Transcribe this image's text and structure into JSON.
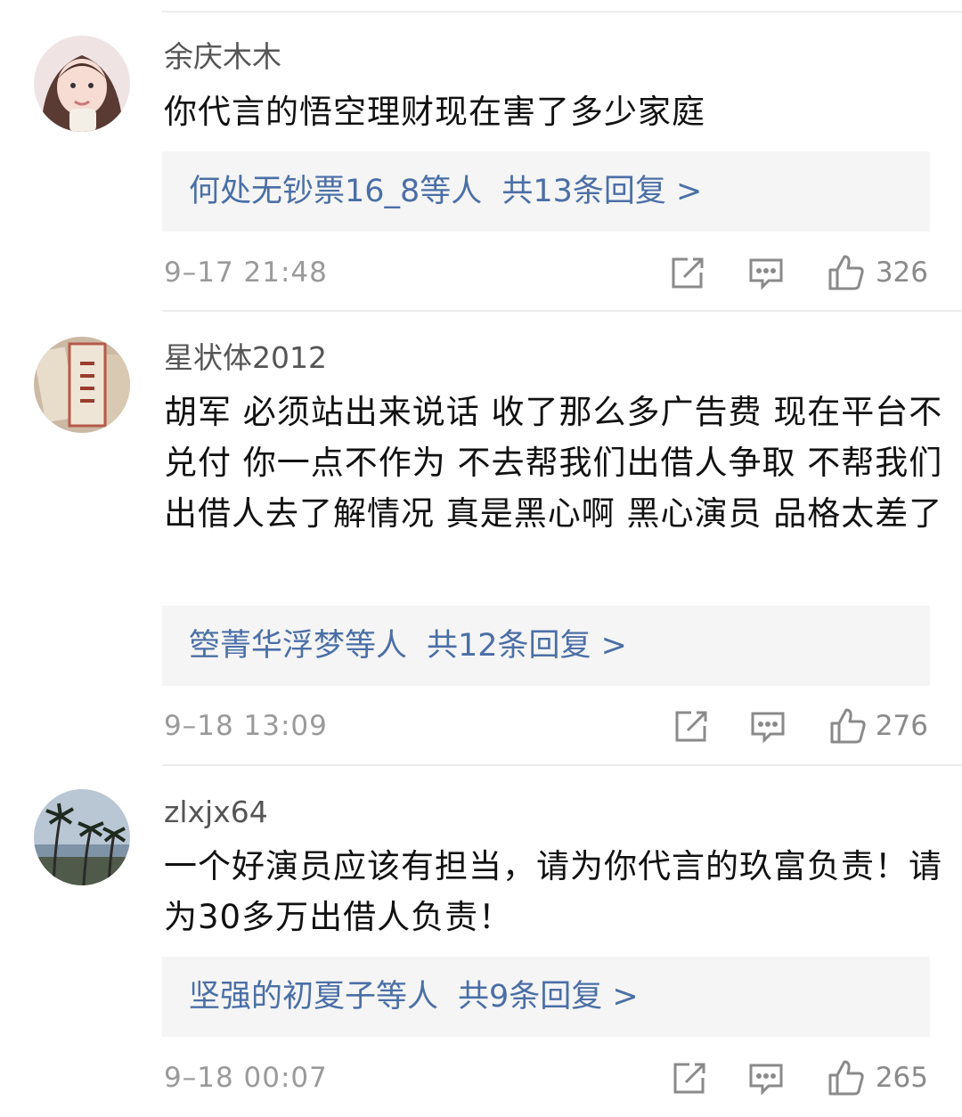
{
  "comments": [
    {
      "username": "余庆木木",
      "text": "你代言的悟空理财现在害了多少家庭",
      "replies": {
        "names": "何处无钞票16_8等人",
        "count": "共13条回复 >"
      },
      "time": "9–17 21:48",
      "likes": "326"
    },
    {
      "username": "星状体2012",
      "text": "胡军 必须站出来说话 收了那么多广告费 现在平台不兑付 你一点不作为 不去帮我们出借人争取 不帮我们出借人去了解情况 真是黑心啊 黑心演员 品格太差了",
      "replies": {
        "names": "箜菁华浮梦等人",
        "count": "共12条回复 >"
      },
      "time": "9–18 13:09",
      "likes": "276"
    },
    {
      "username": "zlxjx64",
      "text": "一个好演员应该有担当，请为你代言的玖富负责！请为30多万出借人负责！",
      "replies": {
        "names": "坚强的初夏子等人",
        "count": "共9条回复 >"
      },
      "time": "9–18 00:07",
      "likes": "265"
    }
  ],
  "icons": {
    "repost": "share-edit-icon",
    "comment": "comment-bubble-icon",
    "like": "thumbs-up-icon"
  },
  "colors": {
    "link": "#4b6fa6",
    "meta": "#9a9a9a",
    "reply_bg": "#f5f5f5"
  }
}
